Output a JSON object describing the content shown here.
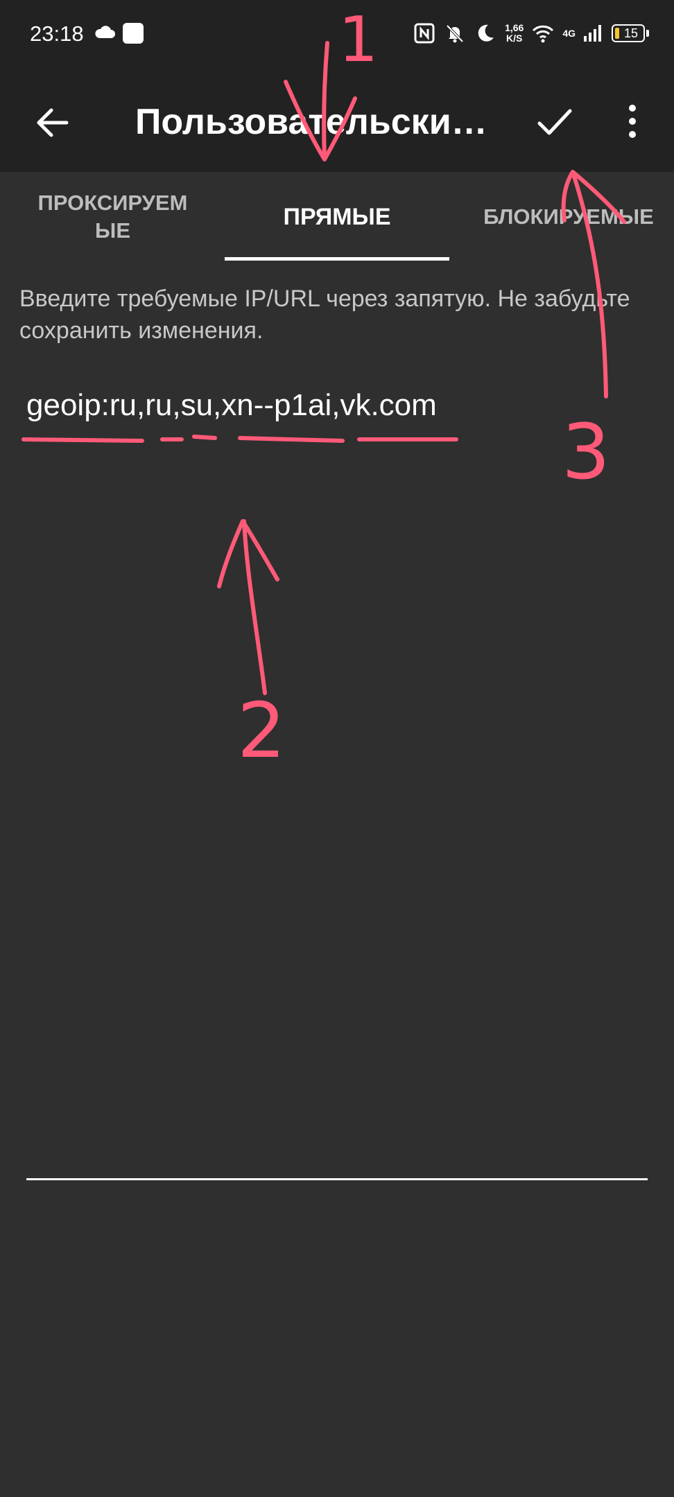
{
  "status_bar": {
    "time": "23:18",
    "speed_value": "1,66",
    "speed_unit": "K/S",
    "network": "4G",
    "battery": "15"
  },
  "app_bar": {
    "title": "Пользовательские…",
    "back_icon": "arrow-left-icon",
    "confirm_icon": "check-icon",
    "menu_icon": "more-vert-icon"
  },
  "tabs": [
    {
      "label": "ПРОКСИРУЕМЫЕ",
      "active": false
    },
    {
      "label": "ПРЯМЫЕ",
      "active": true
    },
    {
      "label": "БЛОКИРУЕМЫЕ",
      "active": false
    }
  ],
  "editor": {
    "hint": "Введите требуемые IP/URL через запятую. Не забудьте сохранить изменения.",
    "value": "geoip:ru,ru,su,xn--p1ai,vk.com"
  },
  "annotations": {
    "marker_1": "1",
    "marker_2": "2",
    "marker_3": "3",
    "color": "#ff5a78"
  },
  "colors": {
    "app_bar_bg": "#222222",
    "content_bg": "#2f2f2f",
    "battery_fill": "#f4c430"
  }
}
